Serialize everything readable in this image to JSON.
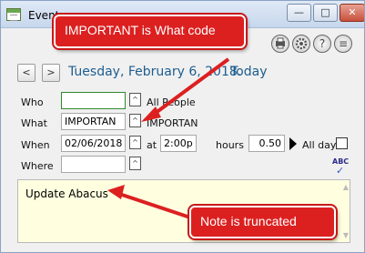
{
  "window": {
    "title": "Event",
    "minimize_glyph": "—",
    "maximize_glyph": "□",
    "close_glyph": "✕"
  },
  "toolbar": {
    "icons": [
      "printer-icon",
      "gear-icon",
      "help-icon",
      "menu-icon"
    ],
    "help_glyph": "?",
    "menu_glyph": "≡"
  },
  "nav": {
    "prev_glyph": "<",
    "next_glyph": ">",
    "date_text": "Tuesday, February 6, 2018.",
    "today_label": "Today"
  },
  "form": {
    "who_label": "Who",
    "who_value": "",
    "who_hint": "All People",
    "what_label": "What",
    "what_value": "IMPORTAN",
    "what_hint": "IMPORTAN",
    "when_label": "When",
    "date_value": "02/06/2018",
    "at_label": "at",
    "time_value": "2:00p",
    "hours_label": "hours",
    "hours_value": "0.50",
    "allday_label": "All day",
    "where_label": "Where",
    "where_value": "",
    "caret_glyph": "^"
  },
  "note": {
    "text": "Update Abacus"
  },
  "annotations": {
    "callout1": "IMPORTANT is What code",
    "callout2": "Note is truncated",
    "color": "#dc2020"
  },
  "spell": {
    "label": "ABC",
    "check": "✓"
  }
}
